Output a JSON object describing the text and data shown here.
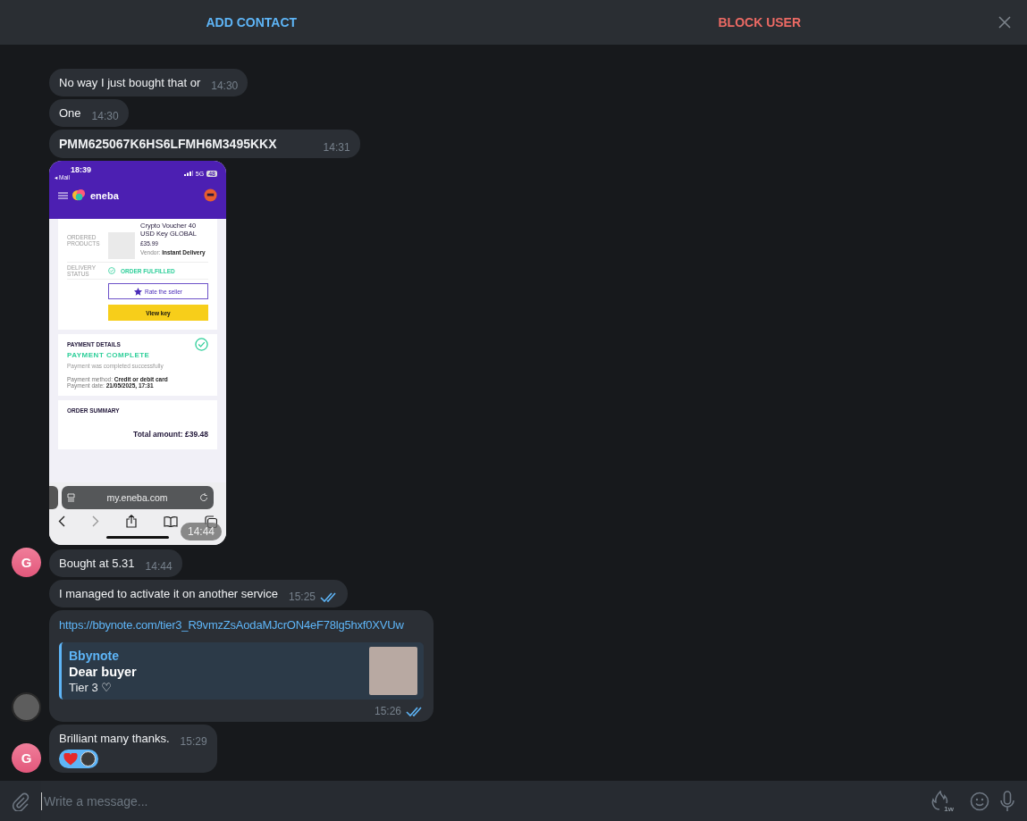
{
  "header": {
    "actions": [
      {
        "kind": "add",
        "label": "ADD CONTACT"
      },
      {
        "kind": "block",
        "label": "BLOCK USER"
      }
    ]
  },
  "messages": [
    {
      "kind": "text",
      "text": "No way I just bought that or",
      "time": "14:30",
      "read": false
    },
    {
      "kind": "text",
      "text": "One",
      "time": "14:30",
      "read": false
    },
    {
      "kind": "code",
      "text": "PMM625067K6HS6LFMH6M3495KKX",
      "time": "14:31",
      "read": false
    },
    {
      "kind": "screenshot",
      "time": "14:44",
      "screenshot": {
        "status_time": "18:39",
        "back_label": "◂ Mail",
        "network": "5G",
        "battery": "48",
        "app_name": "eneba",
        "order": {
          "products_label": "ORDERED PRODUCTS",
          "product_name": "Crypto Voucher 40 USD Key GLOBAL",
          "price": "£35.99",
          "vendor": "Vendor: **Instant Delivery**",
          "status_label": "DELIVERY STATUS",
          "status": "ORDER FULFILLED",
          "rate_button": "Rate the seller",
          "key_button": "View key"
        },
        "payment": {
          "heading": "PAYMENT DETAILS",
          "status": "PAYMENT COMPLETE",
          "note": "Payment was completed successfully",
          "method": "Payment method: **Credit or debit card**",
          "date": "Payment date: **21/05/2025, 17:31**"
        },
        "summary": {
          "heading": "ORDER SUMMARY",
          "total": "Total amount: £39.48"
        },
        "url": "my.eneba.com"
      }
    },
    {
      "kind": "text",
      "text": "Bought at 5.31",
      "time": "14:44",
      "read": false,
      "avatar": {
        "kind": "letter",
        "letter": "G"
      }
    },
    {
      "kind": "text",
      "text": "I managed to activate it on another service",
      "time": "15:25",
      "read": true
    },
    {
      "kind": "link",
      "url": "https://bbynote.com/tier3_R9vmzZsAodaMJcrON4eF78lg5hxf0XVUw",
      "preview": {
        "site": "Bbynote",
        "title": "Dear buyer",
        "description": "Tier 3 ♡"
      },
      "time": "15:26",
      "read": true,
      "avatar": {
        "kind": "photo"
      }
    },
    {
      "kind": "text",
      "text": "Brilliant many thanks.",
      "time": "15:29",
      "read": false,
      "reacted": true,
      "avatar": {
        "kind": "letter",
        "letter": "G"
      }
    }
  ],
  "composer": {
    "placeholder": "Write a message...",
    "timer": "1w"
  }
}
